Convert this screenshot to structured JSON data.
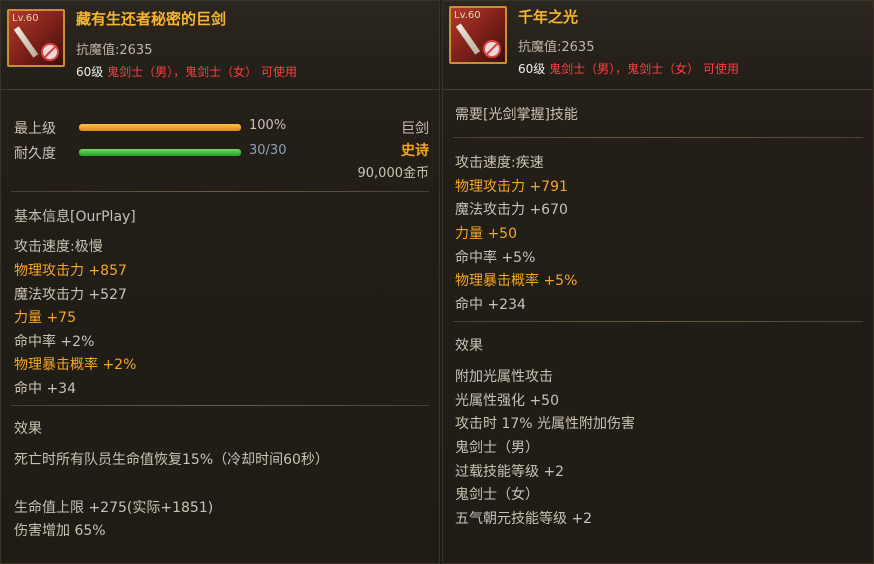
{
  "left": {
    "icon_level": "Lv.60",
    "icon": "sword-icon",
    "name": "藏有生还者秘密的巨剑",
    "resist": "抗魔值:2635",
    "req_level": "60级",
    "classes": "鬼剑士（男），鬼剑士（女）",
    "usable": "可使用",
    "max_level_label": "最上级",
    "max_level_value": "100%",
    "max_level_fraction": 1.0,
    "durability_label": "耐久度",
    "durability_value": "30/30",
    "durability_fraction": 1.0,
    "type": "巨剑",
    "rarity": "史诗",
    "price": "90,000金币",
    "section_basic": "基本信息[OurPlay]",
    "stats": [
      {
        "text": "攻击速度:极慢",
        "highlight": false
      },
      {
        "text": "物理攻击力 +857",
        "highlight": true
      },
      {
        "text": "魔法攻击力 +527",
        "highlight": false
      },
      {
        "text": "力量 +75",
        "highlight": true
      },
      {
        "text": "命中率 +2%",
        "highlight": false
      },
      {
        "text": "物理暴击概率 +2%",
        "highlight": true
      },
      {
        "text": "命中 +34",
        "highlight": false
      }
    ],
    "section_effect": "效果",
    "effects": [
      "死亡时所有队员生命值恢复15%（冷却时间60秒）",
      "生命值上限 +275(实际+1851)",
      "伤害增加 65%"
    ]
  },
  "right": {
    "icon_level": "Lv.60",
    "icon": "sword-icon",
    "name": "千年之光",
    "resist": "抗魔值:2635",
    "req_level": "60级",
    "classes": "鬼剑士（男），鬼剑士（女）",
    "usable": "可使用",
    "requirement": "需要[光剑掌握]技能",
    "stats": [
      {
        "text": "攻击速度:疾速",
        "highlight": false
      },
      {
        "text": "物理攻击力 +791",
        "highlight": true
      },
      {
        "text": "魔法攻击力 +670",
        "highlight": false
      },
      {
        "text": "力量 +50",
        "highlight": true
      },
      {
        "text": "命中率 +5%",
        "highlight": false
      },
      {
        "text": "物理暴击概率 +5%",
        "highlight": true
      },
      {
        "text": "命中 +234",
        "highlight": false
      }
    ],
    "section_effect": "效果",
    "effects": [
      "附加光属性攻击",
      "光属性强化 +50",
      "攻击时 17% 光属性附加伤害",
      "鬼剑士（男）",
      "过载技能等级 +2",
      "鬼剑士（女）",
      "五气朝元技能等级 +2"
    ]
  },
  "colors": {
    "title": "#f5b431",
    "highlight": "#f5a623",
    "red": "#ff3f3f",
    "max_bar": "#f0a020",
    "durability_bar": "#38c838"
  }
}
